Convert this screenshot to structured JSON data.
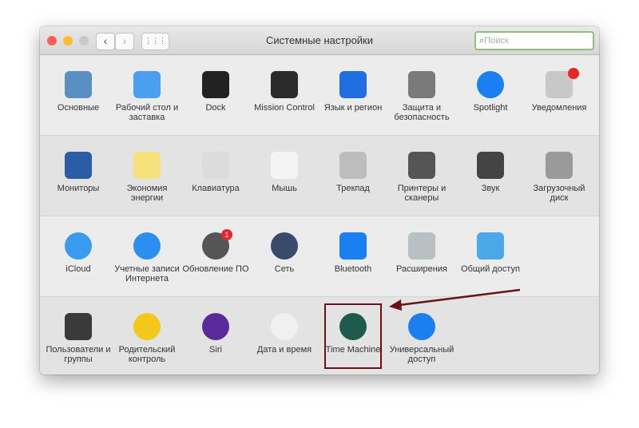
{
  "window": {
    "title": "Системные настройки",
    "search_placeholder": "Поиск",
    "back": "‹",
    "forward": "›",
    "grid": "⋮⋮⋮"
  },
  "badge_count": "1",
  "rows": [
    [
      {
        "id": "general",
        "label": "Основные",
        "color": "#5a8fc4"
      },
      {
        "id": "desktop",
        "label": "Рабочий стол и заставка",
        "color": "#4a9ff0"
      },
      {
        "id": "dock",
        "label": "Dock",
        "color": "#222222"
      },
      {
        "id": "mission-control",
        "label": "Mission Control",
        "color": "#2a2a2a"
      },
      {
        "id": "language",
        "label": "Язык и регион",
        "color": "#1f6fe0"
      },
      {
        "id": "security",
        "label": "Защита и безопасность",
        "color": "#7a7a7a"
      },
      {
        "id": "spotlight",
        "label": "Spotlight",
        "color": "#1a7ff0"
      },
      {
        "id": "notifications",
        "label": "Уведомления",
        "color": "#c8c8c8"
      }
    ],
    [
      {
        "id": "displays",
        "label": "Мониторы",
        "color": "#2a5da8"
      },
      {
        "id": "energy",
        "label": "Экономия энергии",
        "color": "#f5e27a"
      },
      {
        "id": "keyboard",
        "label": "Клавиатура",
        "color": "#dcdcdc"
      },
      {
        "id": "mouse",
        "label": "Мышь",
        "color": "#f4f4f4"
      },
      {
        "id": "trackpad",
        "label": "Трекпад",
        "color": "#bdbdbd"
      },
      {
        "id": "printers",
        "label": "Принтеры и сканеры",
        "color": "#555555"
      },
      {
        "id": "sound",
        "label": "Звук",
        "color": "#444444"
      },
      {
        "id": "startup-disk",
        "label": "Загрузочный диск",
        "color": "#9a9a9a"
      }
    ],
    [
      {
        "id": "icloud",
        "label": "iCloud",
        "color": "#3a9af0"
      },
      {
        "id": "internet-accounts",
        "label": "Учетные записи Интернета",
        "color": "#2b8ff0"
      },
      {
        "id": "software-update",
        "label": "Обновление ПО",
        "color": "#555555"
      },
      {
        "id": "network",
        "label": "Сеть",
        "color": "#3a4a6a"
      },
      {
        "id": "bluetooth",
        "label": "Bluetooth",
        "color": "#1a7ff0"
      },
      {
        "id": "extensions",
        "label": "Расширения",
        "color": "#b8c0c4"
      },
      {
        "id": "sharing",
        "label": "Общий доступ",
        "color": "#4aa8e8"
      }
    ],
    [
      {
        "id": "users",
        "label": "Пользователи и группы",
        "color": "#3a3a3a"
      },
      {
        "id": "parental",
        "label": "Родительский контроль",
        "color": "#f2c81a"
      },
      {
        "id": "siri",
        "label": "Siri",
        "color": "#5a2a9a"
      },
      {
        "id": "date-time",
        "label": "Дата и время",
        "color": "#f0f0f0"
      },
      {
        "id": "time-machine",
        "label": "Time Machine",
        "color": "#1e5a4e"
      },
      {
        "id": "accessibility",
        "label": "Универсальный доступ",
        "color": "#1a7ff0"
      }
    ]
  ]
}
